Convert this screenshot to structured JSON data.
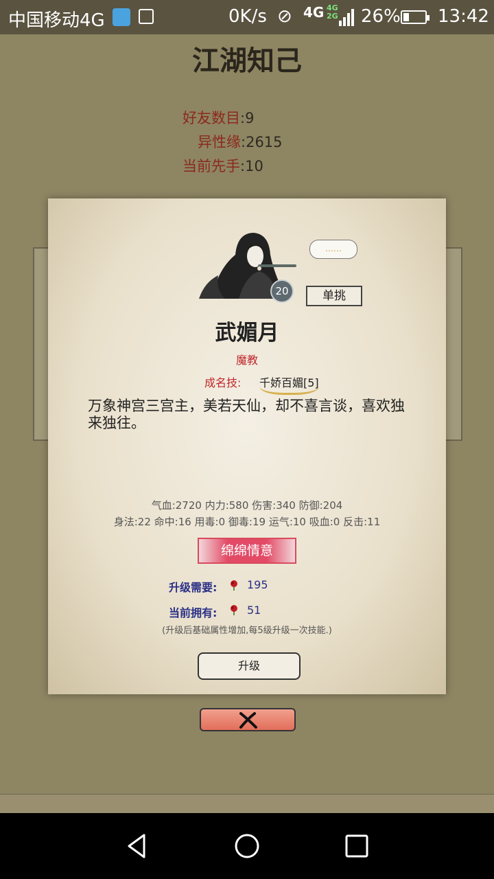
{
  "status_bar": {
    "carrier": "中国移动4G",
    "net_speed": "0K/s",
    "signal": "4G",
    "signal_small": "4G\n2G",
    "battery": "26%",
    "time": "13:42"
  },
  "page": {
    "title": "江湖知己",
    "stats": [
      {
        "key": "好友数目",
        "sep": ":",
        "value": "9"
      },
      {
        "key": "异性缘",
        "sep": ":",
        "value": "2615"
      },
      {
        "key": "当前先手",
        "sep": ":",
        "value": "10"
      }
    ]
  },
  "modal": {
    "level": "20",
    "speech": "……",
    "duel_label": "单挑",
    "name": "武媚月",
    "faction": "魔教",
    "skill_key": "成名技:",
    "skill_value": "千娇百媚[5]",
    "description": "万象神宫三宫主，美若天仙，却不喜言谈，喜欢独来独往。",
    "attrs_line1": "气血:2720  内力:580  伤害:340  防御:204",
    "attrs_line2": "身法:22  命中:16  用毒:0  御毒:19  运气:10  吸血:0  反击:11",
    "bond_label": "绵绵情意",
    "upgrade_need_label": "升级需要:",
    "upgrade_need_value": "195",
    "current_own_label": "当前拥有:",
    "current_own_value": "51",
    "hint": "(升级后基础属性增加,每5级升级一次技能.)",
    "upgrade_label": "升级"
  },
  "icons": {
    "rose": "rose-icon",
    "close": "close-icon"
  },
  "colors": {
    "accent_red": "#c0272d",
    "label_blue": "#2a2f86",
    "bond_pink": "#e24a66"
  }
}
